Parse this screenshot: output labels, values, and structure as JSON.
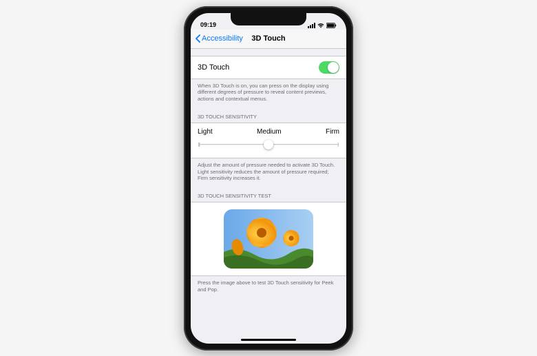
{
  "status": {
    "time": "09:19",
    "signal_icon": "signal-icon",
    "wifi_icon": "wifi-icon",
    "battery_icon": "battery-icon"
  },
  "nav": {
    "back_label": "Accessibility",
    "title": "3D Touch"
  },
  "toggle_row": {
    "label": "3D Touch",
    "on": true
  },
  "toggle_footer": "When 3D Touch is on, you can press on the display using different degrees of pressure to reveal content previews, actions and contextual menus.",
  "sensitivity": {
    "header": "3D TOUCH SENSITIVITY",
    "labels": {
      "light": "Light",
      "medium": "Medium",
      "firm": "Firm"
    },
    "value": "Medium",
    "footer": "Adjust the amount of pressure needed to activate 3D Touch. Light sensitivity reduces the amount of pressure required; Firm sensitivity increases it."
  },
  "test": {
    "header": "3D TOUCH SENSITIVITY TEST",
    "image_name": "flowers-sample-image",
    "footer": "Press the image above to test 3D Touch sensitivity for Peek and Pop."
  },
  "colors": {
    "link": "#007aff",
    "toggle_on": "#4cd964"
  }
}
